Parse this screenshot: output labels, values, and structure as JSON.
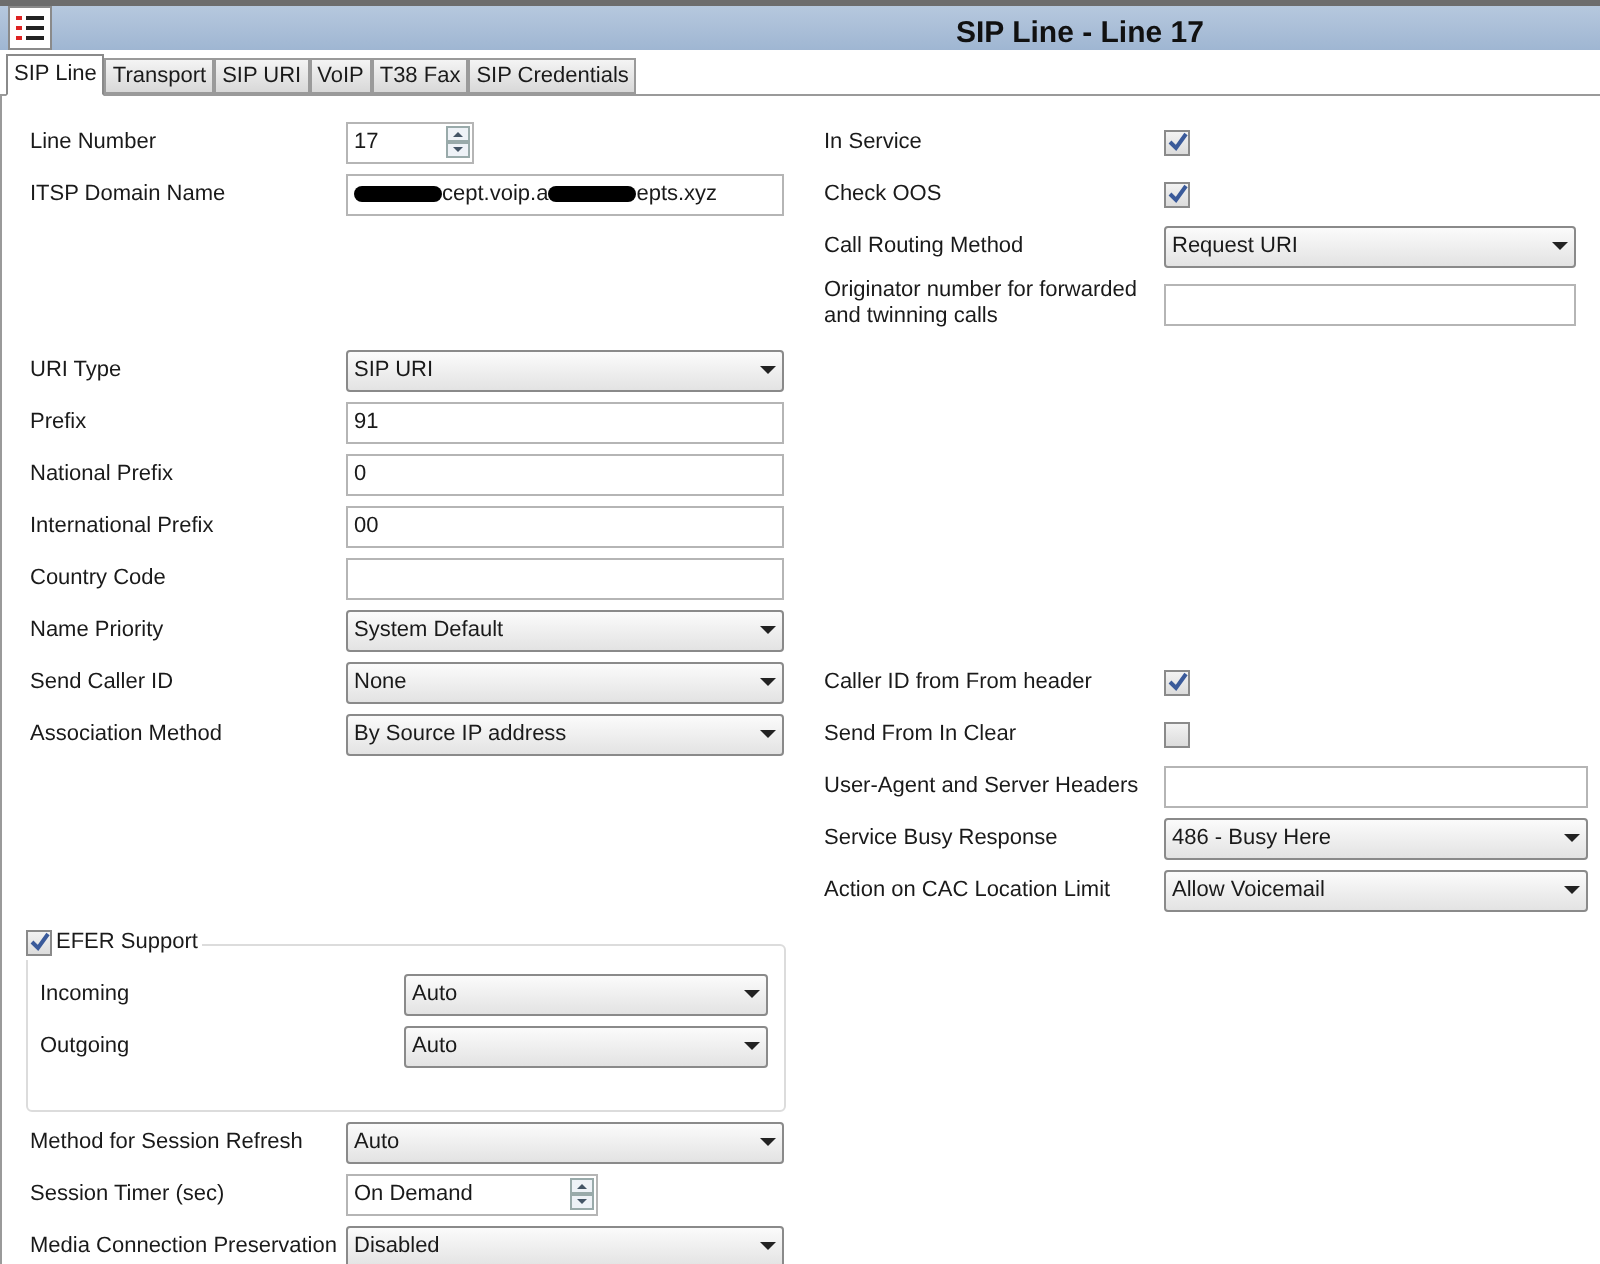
{
  "window": {
    "title": "SIP Line - Line 17"
  },
  "tabs": [
    {
      "label": "SIP Line",
      "selected": true
    },
    {
      "label": "Transport",
      "selected": false
    },
    {
      "label": "SIP URI",
      "selected": false
    },
    {
      "label": "VoIP",
      "selected": false
    },
    {
      "label": "T38 Fax",
      "selected": false
    },
    {
      "label": "SIP Credentials",
      "selected": false
    }
  ],
  "left_groups": [
    [
      {
        "kind": "spin",
        "label": "Line Number",
        "value": "17"
      },
      {
        "kind": "redacted_text",
        "label": "ITSP Domain Name",
        "segments": [
          {
            "kind": "redacted"
          },
          {
            "kind": "text",
            "text": "cept.voip.a"
          },
          {
            "kind": "redacted"
          },
          {
            "kind": "text",
            "text": "epts.xyz"
          }
        ]
      }
    ],
    [
      {
        "kind": "select",
        "label": "URI Type",
        "value": "SIP URI"
      },
      {
        "kind": "text",
        "label": "Prefix",
        "value": "91"
      },
      {
        "kind": "text",
        "label": "National Prefix",
        "value": "0"
      },
      {
        "kind": "text",
        "label": "International Prefix",
        "value": "00"
      },
      {
        "kind": "text",
        "label": "Country Code"
      },
      {
        "kind": "select",
        "label": "Name Priority",
        "value": "System Default"
      },
      {
        "kind": "select",
        "label": "Send Caller ID",
        "value": "None"
      },
      {
        "kind": "select",
        "label": "Association Method",
        "value": "By Source IP address"
      }
    ]
  ],
  "refer": {
    "label": "EFER Support",
    "checked": true,
    "rows": [
      {
        "kind": "select",
        "label": "Incoming",
        "value": "Auto"
      },
      {
        "kind": "select",
        "label": "Outgoing",
        "value": "Auto"
      }
    ]
  },
  "bottom_rows": [
    {
      "kind": "select",
      "label": "Method for Session Refresh",
      "value": "Auto"
    },
    {
      "kind": "spin",
      "label": "Session Timer (sec)",
      "value": "On Demand"
    },
    {
      "kind": "select",
      "label": "Media Connection Preservation",
      "value": "Disabled"
    }
  ],
  "right_groups": [
    [
      {
        "kind": "check",
        "label": "In Service",
        "checked": true
      },
      {
        "kind": "check",
        "label": "Check OOS",
        "checked": true
      },
      {
        "kind": "select",
        "label": "Call Routing Method",
        "value": "Request URI"
      },
      {
        "kind": "text",
        "label": "Originator number for forwarded and twinning calls"
      }
    ],
    [
      {
        "kind": "check",
        "label": "Caller ID from From header",
        "checked": true
      },
      {
        "kind": "check",
        "label": "Send From In Clear",
        "checked": false
      },
      {
        "kind": "text",
        "label": "User-Agent and Server Headers"
      },
      {
        "kind": "select",
        "label": "Service Busy Response",
        "value": "486 - Busy Here"
      },
      {
        "kind": "select",
        "label": "Action on CAC Location Limit",
        "value": "Allow Voicemail"
      }
    ]
  ]
}
